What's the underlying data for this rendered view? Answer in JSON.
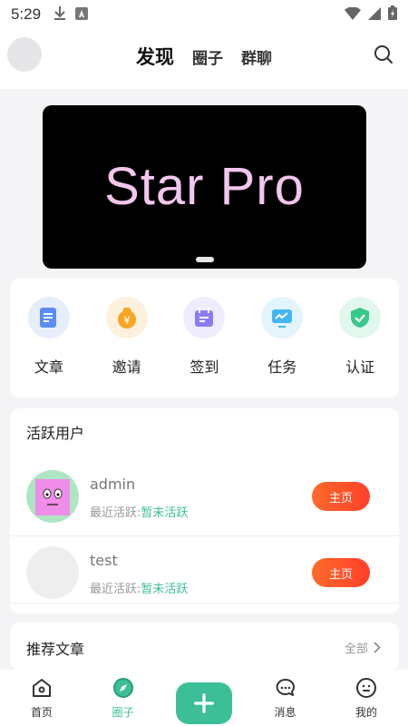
{
  "status_bar": {
    "time": "5:29"
  },
  "header": {
    "tabs": [
      {
        "label": "发现",
        "active": true
      },
      {
        "label": "圈子",
        "active": false
      },
      {
        "label": "群聊",
        "active": false
      }
    ]
  },
  "banner": {
    "text": "Star Pro"
  },
  "quick_actions": [
    {
      "label": "文章",
      "icon": "article-icon",
      "color": "#5b8cf0"
    },
    {
      "label": "邀请",
      "icon": "invite-icon",
      "color": "#f5a623"
    },
    {
      "label": "签到",
      "icon": "checkin-icon",
      "color": "#8b7cf6"
    },
    {
      "label": "任务",
      "icon": "task-icon",
      "color": "#41b6f2"
    },
    {
      "label": "认证",
      "icon": "verify-icon",
      "color": "#35c98a"
    }
  ],
  "active_users": {
    "title": "活跃用户",
    "recent_label": "最近活跃:",
    "button_label": "主页",
    "users": [
      {
        "name": "admin",
        "status": "暂未活跃"
      },
      {
        "name": "test",
        "status": "暂未活跃"
      }
    ]
  },
  "articles": {
    "title": "推荐文章",
    "all_label": "全部"
  },
  "bottom_nav": [
    {
      "label": "首页",
      "icon": "home-icon"
    },
    {
      "label": "圈子",
      "icon": "compass-icon",
      "active": true
    },
    {
      "label": "",
      "icon": "plus-icon"
    },
    {
      "label": "消息",
      "icon": "message-icon"
    },
    {
      "label": "我的",
      "icon": "profile-icon"
    }
  ],
  "colors": {
    "accent": "#3cbf97",
    "button": "#ff5a2a",
    "banner_text": "#f3c6ee"
  }
}
